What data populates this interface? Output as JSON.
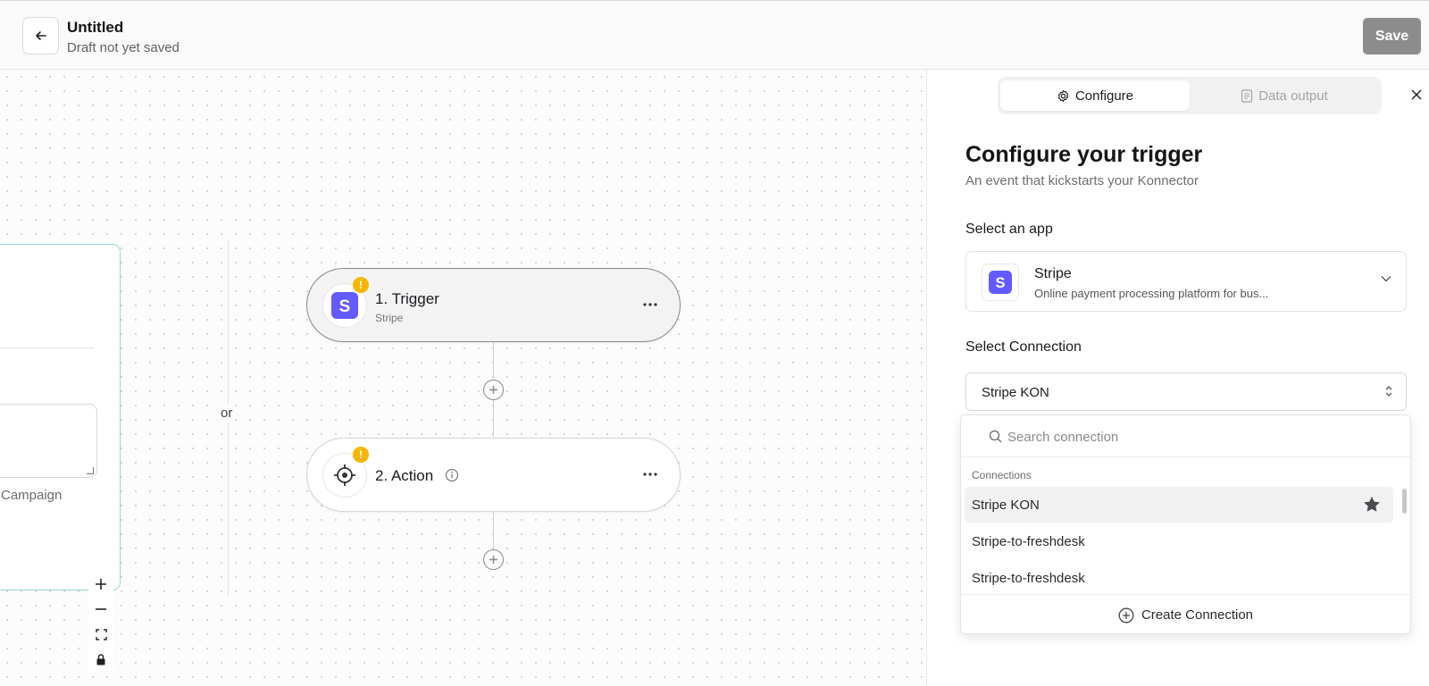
{
  "header": {
    "title": "Untitled",
    "subtitle": "Draft not yet saved",
    "save_label": "Save"
  },
  "canvas": {
    "campaign_text": "Campaign",
    "or_label": "or",
    "nodes": [
      {
        "title": "1. Trigger",
        "subtitle": "Stripe",
        "icon": "stripe-logo-icon",
        "warning": "!"
      },
      {
        "title": "2. Action",
        "subtitle": "",
        "icon": "crosshair-icon",
        "warning": "!"
      }
    ],
    "more_label": "···"
  },
  "panel": {
    "tabs": [
      {
        "label": "Configure",
        "icon": "gear-icon",
        "active": true
      },
      {
        "label": "Data output",
        "icon": "document-icon",
        "active": false
      }
    ],
    "title": "Configure your trigger",
    "subtitle": "An event that kickstarts your Konnector",
    "select_app_label": "Select an app",
    "app": {
      "name": "Stripe",
      "description": "Online payment processing platform for bus..."
    },
    "select_connection_label": "Select Connection",
    "connection_value": "Stripe KON",
    "dropdown": {
      "search_placeholder": "Search connection",
      "group_label": "Connections",
      "options": [
        {
          "label": "Stripe KON",
          "starred": true
        },
        {
          "label": "Stripe-to-freshdesk",
          "starred": false
        },
        {
          "label": "Stripe-to-freshdesk",
          "starred": false
        }
      ],
      "create_label": "Create Connection"
    }
  },
  "colors": {
    "stripe_brand": "#635bff",
    "warning": "#f7b500",
    "save_disabled": "#8c8c8c",
    "side_card_border": "#8fd8d6"
  }
}
